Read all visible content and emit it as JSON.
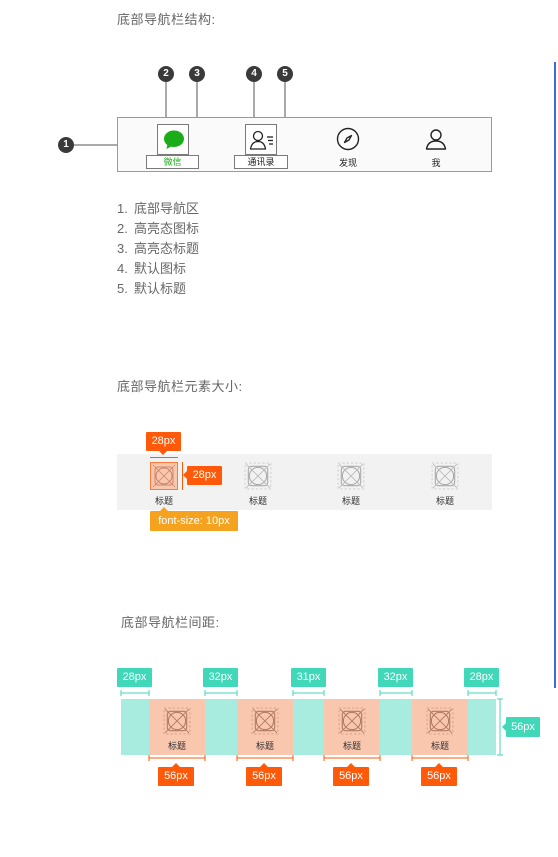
{
  "section1": {
    "title": "底部导航栏结构:",
    "nav_items": [
      "微信",
      "通讯录",
      "发现",
      "我"
    ],
    "badges": [
      "1",
      "2",
      "3",
      "4",
      "5"
    ],
    "legend": [
      {
        "num": "1.",
        "text": "底部导航区"
      },
      {
        "num": "2.",
        "text": "高亮态图标"
      },
      {
        "num": "3.",
        "text": "高亮态标题"
      },
      {
        "num": "4.",
        "text": "默认图标"
      },
      {
        "num": "5.",
        "text": "默认标题"
      }
    ],
    "highlight_color": "#1aad19"
  },
  "section2": {
    "title": "底部导航栏元素大小:",
    "item_label": "标题",
    "width_tag": "28px",
    "height_tag": "28px",
    "font_tag": "font-size: 10px"
  },
  "section3": {
    "title": "底部导航栏间距:",
    "item_label": "标题",
    "gap_tags": [
      "28px",
      "32px",
      "31px",
      "32px",
      "28px"
    ],
    "item_tags": [
      "56px",
      "56px",
      "56px",
      "56px"
    ],
    "height_tag": "56px"
  },
  "colors": {
    "accent_orange": "#ff5a0a",
    "accent_yellow": "#f5a31f",
    "accent_teal": "#40d8b8",
    "teal_fill": "#a8ecdf",
    "peach_fill": "#f9c6ae"
  }
}
